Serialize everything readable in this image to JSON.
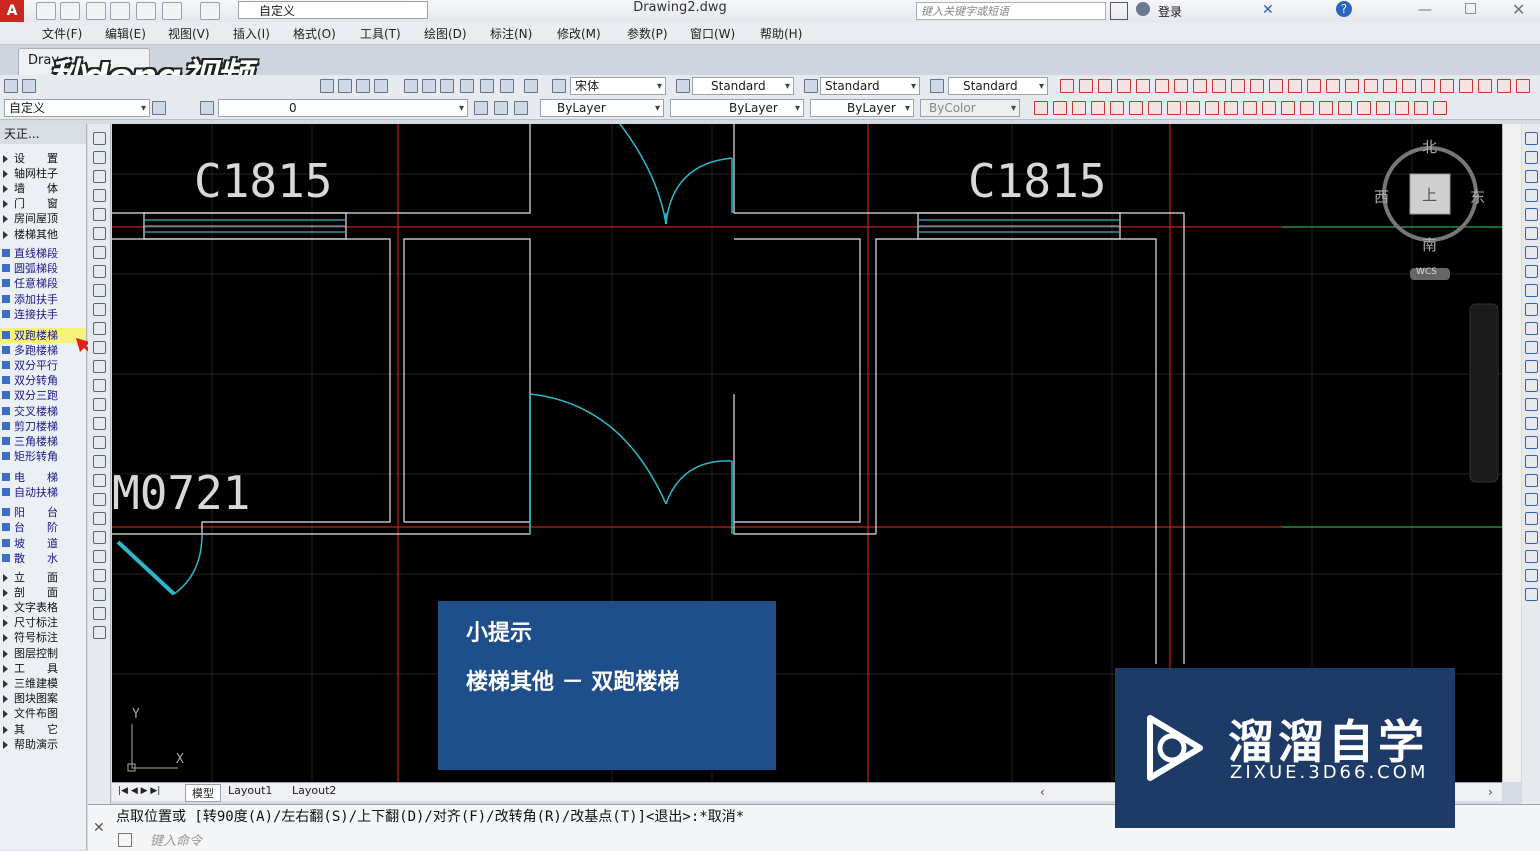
{
  "titlebar": {
    "workspace": "自定义",
    "document_title": "Drawing2.dwg",
    "search_placeholder": "键入关键字或短语",
    "login_label": "登录"
  },
  "menu": [
    "文件(F)",
    "编辑(E)",
    "视图(V)",
    "插入(I)",
    "格式(O)",
    "工具(T)",
    "绘图(D)",
    "标注(N)",
    "修改(M)",
    "参数(P)",
    "窗口(W)",
    "帮助(H)"
  ],
  "file_tab": {
    "label": "Drav"
  },
  "watermark": "秒dong视频",
  "toolbar1": {
    "font": "宋体",
    "text_style": "Standard",
    "dim_style": "Standard",
    "table_style": "Standard"
  },
  "toolbar2": {
    "workspace": "自定义",
    "layer": "0",
    "color": "ByLayer",
    "linetype": "ByLayer",
    "lineweight": "ByLayer",
    "plotstyle": "ByColor"
  },
  "panel": {
    "title": "天正...",
    "items": [
      {
        "label": "设　　置",
        "type": "group"
      },
      {
        "label": "轴网柱子",
        "type": "group"
      },
      {
        "label": "墙　　体",
        "type": "group"
      },
      {
        "label": "门　　窗",
        "type": "group"
      },
      {
        "label": "房间屋顶",
        "type": "group"
      },
      {
        "label": "楼梯其他",
        "type": "group-open"
      },
      {
        "label": "直线梯段",
        "type": "sub"
      },
      {
        "label": "圆弧梯段",
        "type": "sub"
      },
      {
        "label": "任意梯段",
        "type": "sub"
      },
      {
        "label": "添加扶手",
        "type": "sub"
      },
      {
        "label": "连接扶手",
        "type": "sub"
      },
      {
        "label": "双跑楼梯",
        "type": "sub-hl"
      },
      {
        "label": "多跑楼梯",
        "type": "sub"
      },
      {
        "label": "双分平行",
        "type": "sub"
      },
      {
        "label": "双分转角",
        "type": "sub"
      },
      {
        "label": "双分三跑",
        "type": "sub"
      },
      {
        "label": "交叉楼梯",
        "type": "sub"
      },
      {
        "label": "剪刀楼梯",
        "type": "sub"
      },
      {
        "label": "三角楼梯",
        "type": "sub"
      },
      {
        "label": "矩形转角",
        "type": "sub"
      },
      {
        "label": "电　　梯",
        "type": "sub"
      },
      {
        "label": "自动扶梯",
        "type": "sub"
      },
      {
        "label": "阳　　台",
        "type": "sub"
      },
      {
        "label": "台　　阶",
        "type": "sub"
      },
      {
        "label": "坡　　道",
        "type": "sub"
      },
      {
        "label": "散　　水",
        "type": "sub"
      },
      {
        "label": "立　　面",
        "type": "group"
      },
      {
        "label": "剖　　面",
        "type": "group"
      },
      {
        "label": "文字表格",
        "type": "group"
      },
      {
        "label": "尺寸标注",
        "type": "group"
      },
      {
        "label": "符号标注",
        "type": "group"
      },
      {
        "label": "图层控制",
        "type": "group"
      },
      {
        "label": "工　　具",
        "type": "group"
      },
      {
        "label": "三维建模",
        "type": "group"
      },
      {
        "label": "图块图案",
        "type": "group"
      },
      {
        "label": "文件布图",
        "type": "group"
      },
      {
        "label": "其　　它",
        "type": "group"
      },
      {
        "label": "帮助演示",
        "type": "group"
      }
    ]
  },
  "drawing": {
    "window_label_1": "C1815",
    "window_label_2": "C1815",
    "door_label": "M0721",
    "ucs_y": "Y",
    "ucs_x": "X"
  },
  "viewcube": {
    "north": "北",
    "south": "南",
    "east": "东",
    "west": "西",
    "face": "上",
    "wcs": "WCS"
  },
  "layout_tabs": [
    "模型",
    "Layout1",
    "Layout2"
  ],
  "command": {
    "line": "点取位置或 [转90度(A)/左右翻(S)/上下翻(D)/对齐(F)/改转角(R)/改基点(T)]<退出>:*取消*",
    "placeholder": "键入命令"
  },
  "tip": {
    "title": "小提示",
    "body": "楼梯其他 － 双跑楼梯"
  },
  "brand": {
    "name": "溜溜自学",
    "url": "ZIXUE.3D66.COM"
  },
  "colors": {
    "canvas": "#000000",
    "axis": "#c81e1e",
    "wall": "#e6e6e6",
    "door": "#2fb7c9",
    "tip": "#1f4f8a",
    "brand": "#1e3a67"
  }
}
